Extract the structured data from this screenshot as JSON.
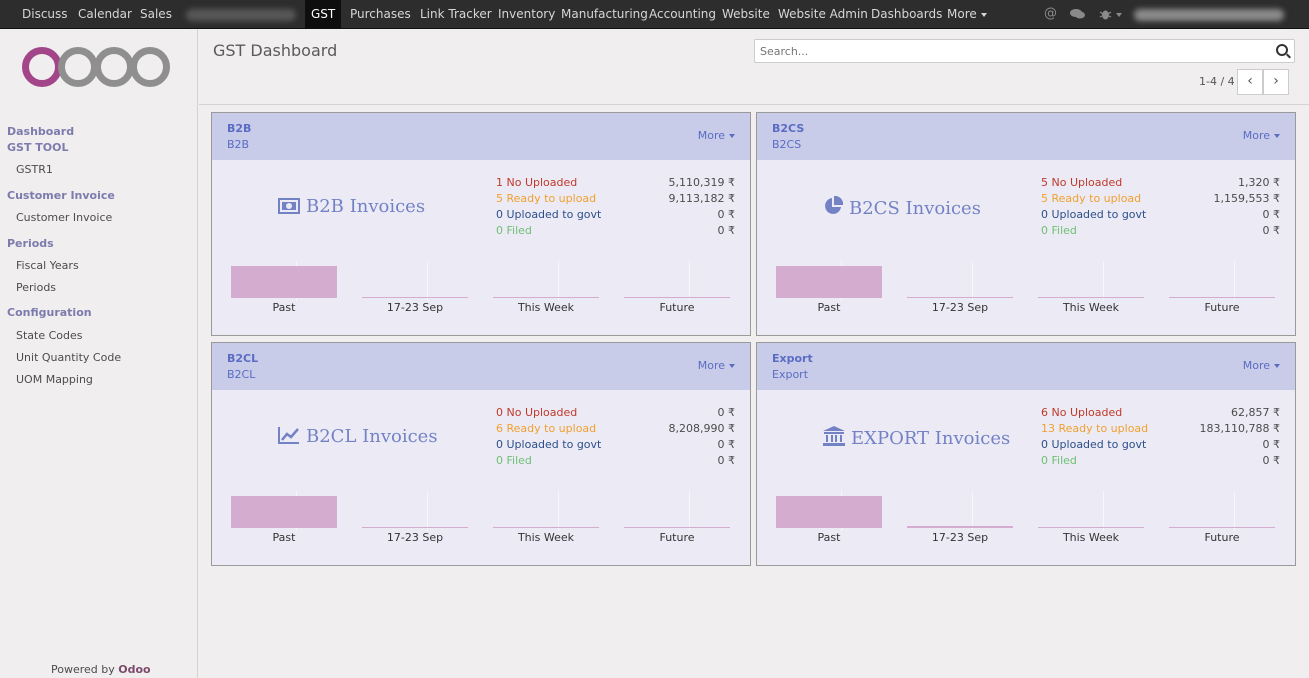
{
  "topbar": {
    "items": [
      "Discuss",
      "Calendar",
      "Sales",
      "GST",
      "Purchases",
      "Link Tracker",
      "Inventory",
      "Manufacturing",
      "Accounting",
      "Website",
      "Website Admin",
      "Dashboards",
      "More"
    ],
    "active": "GST"
  },
  "sidebar": {
    "sections": [
      {
        "head": "Dashboard",
        "items": []
      },
      {
        "head": "GST TOOL",
        "items": [
          "GSTR1"
        ]
      },
      {
        "head": "Customer Invoice",
        "items": [
          "Customer Invoice"
        ]
      },
      {
        "head": "Periods",
        "items": [
          "Fiscal Years",
          "Periods"
        ]
      },
      {
        "head": "Configuration",
        "items": [
          "State Codes",
          "Unit Quantity Code",
          "UOM Mapping"
        ]
      }
    ],
    "powered_prefix": "Powered by",
    "powered_brand": "Odoo"
  },
  "control": {
    "title": "GST Dashboard",
    "search_placeholder": "Search...",
    "pager": "1-4 / 4"
  },
  "cards": [
    {
      "code": "B2B",
      "sub": "B2B",
      "more": "More",
      "big": "B2B Invoices",
      "icon": "money-icon",
      "stats": [
        {
          "label": "1 No Uploaded",
          "value": "5,110,319 ₹"
        },
        {
          "label": "5 Ready to upload",
          "value": "9,113,182 ₹"
        },
        {
          "label": "0 Uploaded to govt",
          "value": "0 ₹"
        },
        {
          "label": "0 Filed",
          "value": "0 ₹"
        }
      ],
      "bars": [
        {
          "label": "Past",
          "level": 1.0
        },
        {
          "label": "17-23 Sep",
          "level": 0.03
        },
        {
          "label": "This Week",
          "level": 0.03
        },
        {
          "label": "Future",
          "level": 0.03
        }
      ]
    },
    {
      "code": "B2CS",
      "sub": "B2CS",
      "more": "More",
      "big": "B2CS Invoices",
      "icon": "pie-chart-icon",
      "stats": [
        {
          "label": "5 No Uploaded",
          "value": "1,320 ₹"
        },
        {
          "label": "5 Ready to upload",
          "value": "1,159,553 ₹"
        },
        {
          "label": "0 Uploaded to govt",
          "value": "0 ₹"
        },
        {
          "label": "0 Filed",
          "value": "0 ₹"
        }
      ],
      "bars": [
        {
          "label": "Past",
          "level": 1.0
        },
        {
          "label": "17-23 Sep",
          "level": 0.03
        },
        {
          "label": "This Week",
          "level": 0.03
        },
        {
          "label": "Future",
          "level": 0.03
        }
      ]
    },
    {
      "code": "B2CL",
      "sub": "B2CL",
      "more": "More",
      "big": "B2CL Invoices",
      "icon": "line-chart-icon",
      "stats": [
        {
          "label": "0 No Uploaded",
          "value": "0 ₹"
        },
        {
          "label": "6 Ready to upload",
          "value": "8,208,990 ₹"
        },
        {
          "label": "0 Uploaded to govt",
          "value": "0 ₹"
        },
        {
          "label": "0 Filed",
          "value": "0 ₹"
        }
      ],
      "bars": [
        {
          "label": "Past",
          "level": 1.0
        },
        {
          "label": "17-23 Sep",
          "level": 0.03
        },
        {
          "label": "This Week",
          "level": 0.03
        },
        {
          "label": "Future",
          "level": 0.03
        }
      ]
    },
    {
      "code": "Export",
      "sub": "Export",
      "more": "More",
      "big": "EXPORT Invoices",
      "icon": "bank-icon",
      "stats": [
        {
          "label": "6 No Uploaded",
          "value": "62,857 ₹"
        },
        {
          "label": "13 Ready to upload",
          "value": "183,110,788 ₹"
        },
        {
          "label": "0 Uploaded to govt",
          "value": "0 ₹"
        },
        {
          "label": "0 Filed",
          "value": "0 ₹"
        }
      ],
      "bars": [
        {
          "label": "Past",
          "level": 1.0
        },
        {
          "label": "17-23 Sep",
          "level": 0.06
        },
        {
          "label": "This Week",
          "level": 0.03
        },
        {
          "label": "Future",
          "level": 0.03
        }
      ]
    }
  ],
  "colors": {
    "accent": "#5a6cc4",
    "bar": "#d3acd0",
    "nav": "#2d2d2d"
  }
}
